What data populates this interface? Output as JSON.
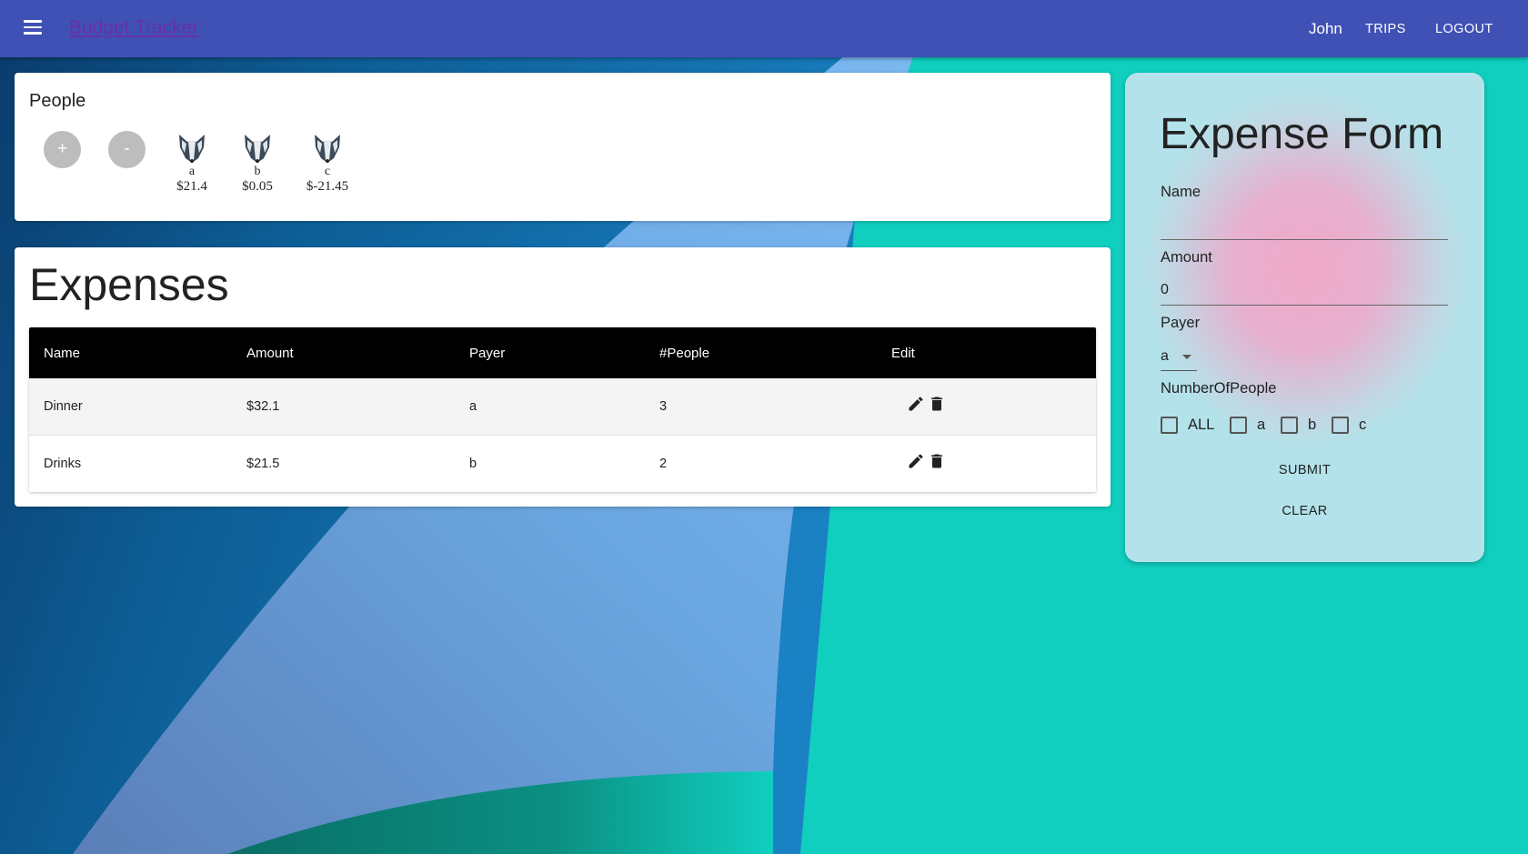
{
  "appbar": {
    "brand": "Budget Tracker",
    "user": "John",
    "trips_label": "TRIPS",
    "logout_label": "LOGOUT"
  },
  "people": {
    "title": "People",
    "add_label": "+",
    "remove_label": "-",
    "list": [
      {
        "name": "a",
        "balance": "$21.4"
      },
      {
        "name": "b",
        "balance": "$0.05"
      },
      {
        "name": "c",
        "balance": "$-21.45"
      }
    ]
  },
  "expenses": {
    "title": "Expenses",
    "columns": [
      "Name",
      "Amount",
      "Payer",
      "#People",
      "Edit"
    ],
    "rows": [
      {
        "name": "Dinner",
        "amount": "$32.1",
        "payer": "a",
        "people": "3"
      },
      {
        "name": "Drinks",
        "amount": "$21.5",
        "payer": "b",
        "people": "2"
      }
    ]
  },
  "form": {
    "title": "Expense Form",
    "name_label": "Name",
    "name_value": "",
    "amount_label": "Amount",
    "amount_value": "0",
    "payer_label": "Payer",
    "payer_value": "a",
    "people_label": "NumberOfPeople",
    "checkboxes": [
      "ALL",
      "a",
      "b",
      "c"
    ],
    "submit_label": "SUBMIT",
    "clear_label": "CLEAR"
  },
  "colors": {
    "appbar": "#3f51b5",
    "background": "#10cfbf",
    "table_header": "#000000"
  }
}
